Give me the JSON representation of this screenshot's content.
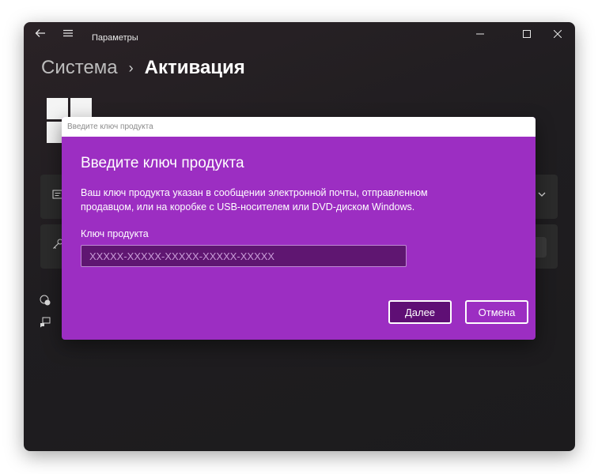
{
  "window": {
    "title": "Параметры",
    "back_icon": "back-arrow-icon",
    "menu_icon": "hamburger-icon",
    "controls": {
      "minimize": "—",
      "maximize": "☐",
      "close": "✕"
    }
  },
  "breadcrumb": {
    "parent": "Система",
    "separator": "›",
    "current": "Активация"
  },
  "dialog": {
    "bar_title": "Введите ключ продукта",
    "heading": "Введите ключ продукта",
    "description": "Ваш ключ продукта указан в сообщении электронной почты, отправленном продавцом, или на коробке с USB-носителем или DVD-диском Windows.",
    "field_label": "Ключ продукта",
    "field_placeholder": "XXXXX-XXXXX-XXXXX-XXXXX-XXXXX",
    "field_value": "",
    "next_label": "Далее",
    "cancel_label": "Отмена"
  },
  "colors": {
    "dialog_bg": "#9c2ec2",
    "accent_dark": "#5f0f75"
  }
}
